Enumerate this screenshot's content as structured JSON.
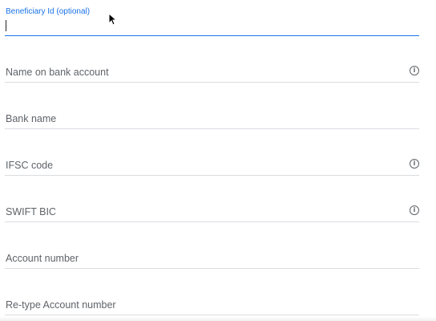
{
  "form": {
    "fields": [
      {
        "label": "Beneficiary Id (optional)",
        "value": "",
        "state": "focused",
        "info_icon": false
      },
      {
        "label": "Name on bank account",
        "value": "",
        "info_icon": true
      },
      {
        "label": "Bank name",
        "value": "",
        "info_icon": false
      },
      {
        "label": "IFSC code",
        "value": "",
        "info_icon": true
      },
      {
        "label": "SWIFT BIC",
        "value": "",
        "info_icon": true
      },
      {
        "label": "Account number",
        "value": "",
        "info_icon": false
      },
      {
        "label": "Re-type Account number",
        "value": "",
        "info_icon": false
      }
    ],
    "info_icon_name": "info-icon",
    "colors": {
      "focus_accent": "#1a73e8",
      "label": "#5f6368",
      "divider": "#dadce0"
    }
  }
}
